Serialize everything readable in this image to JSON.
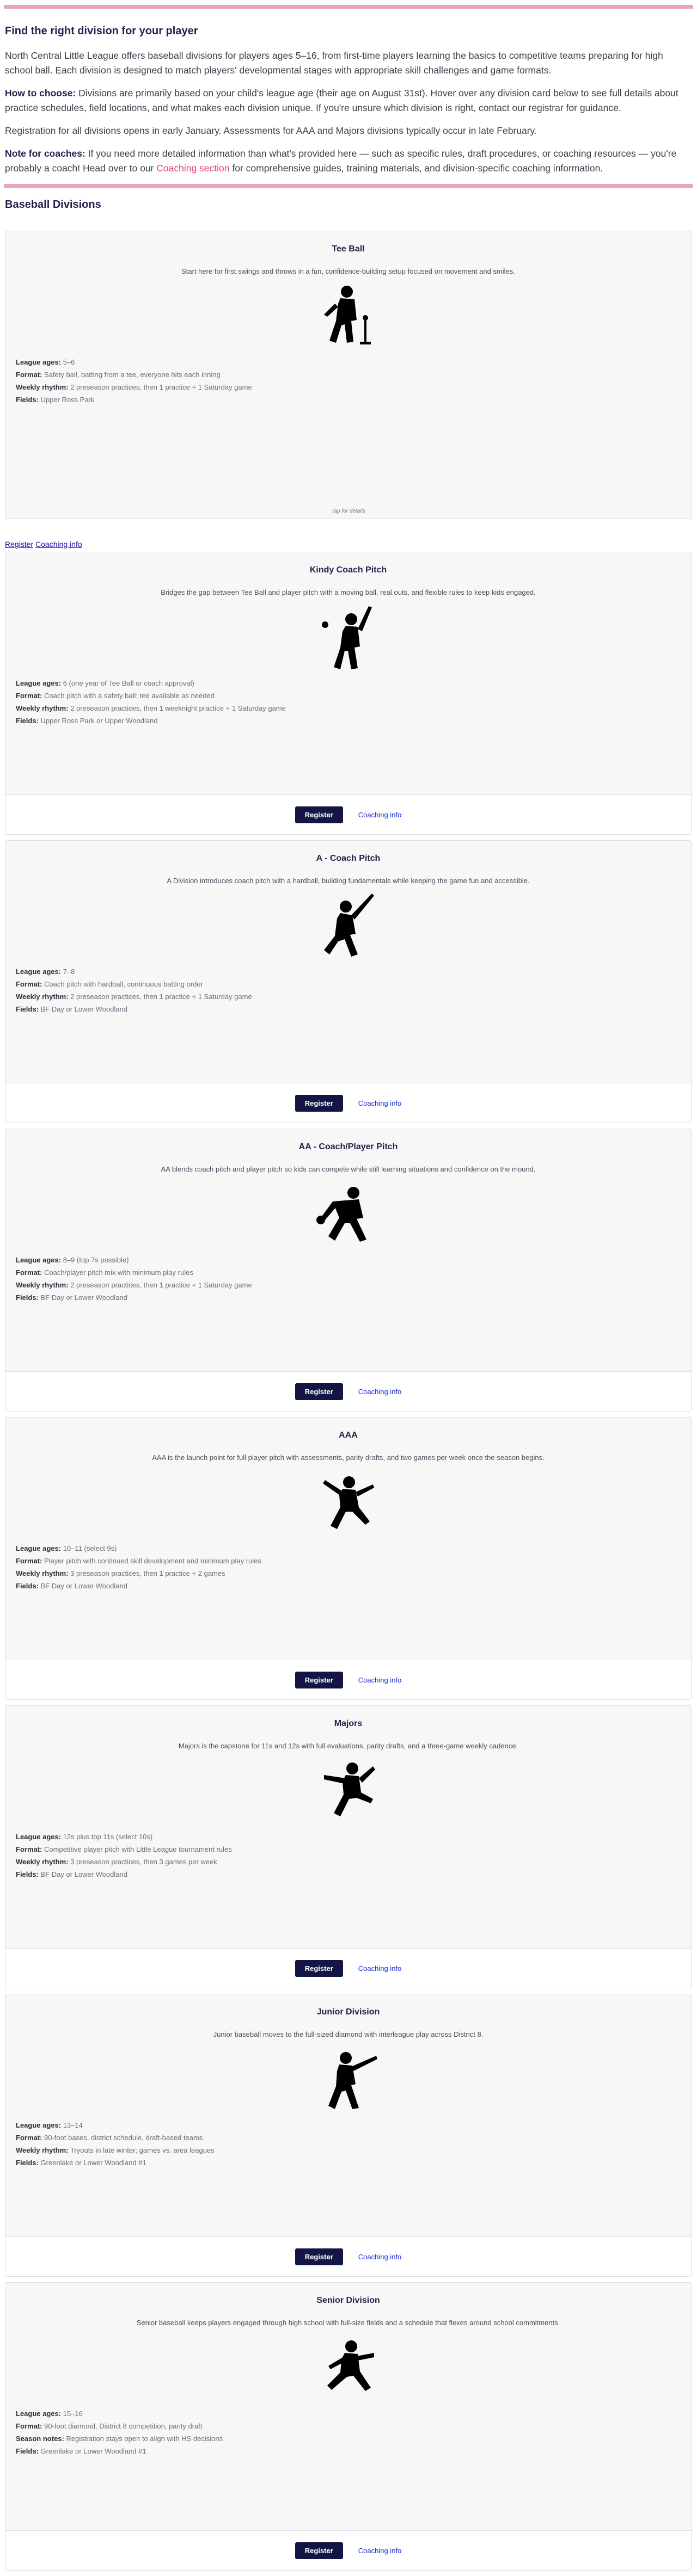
{
  "intro": {
    "title": "Find the right division for your player",
    "overview": "North Central Little League offers baseball divisions for players ages 5–16, from first-time players learning the basics to competitive teams preparing for high school ball. Each division is designed to match players' developmental stages with appropriate skill challenges and game formats.",
    "how_label": "How to choose:",
    "how_text": " Divisions are primarily based on your child's league age (their age on August 31st). Hover over any division card below to see full details about practice schedules, field locations, and what makes each division unique. If you're unsure which division is right, contact our registrar for guidance.",
    "registration": "Registration for all divisions opens in early January. Assessments for AAA and Majors divisions typically occur in late February.",
    "coach_label": "Note for coaches:",
    "coach_text_a": " If you need more detailed information than what's provided here — such as specific rules, draft procedures, or coaching resources — you're probably a coach! Head over to our ",
    "coach_link": "Coaching section",
    "coach_text_b": " for comprehensive guides, training materials, and division-specific coaching information."
  },
  "section_title": "Baseball Divisions",
  "plain_links": {
    "register": "Register",
    "coaching": "Coaching info"
  },
  "labels": {
    "league_ages": "League ages:",
    "format": "Format:",
    "weekly_rhythm": "Weekly rhythm:",
    "season_notes": "Season notes:",
    "fields": "Fields:",
    "register": "Register",
    "coaching_info": "Coaching info",
    "tap_details": "Tap for details"
  },
  "divisions": [
    {
      "name": "Tee Ball",
      "description": "Start here for first swings and throws in a fun, confidence-building setup focused on movement and smiles.",
      "icon": "tee-ball-batter-icon",
      "ages": "5–6",
      "format": "Safety ball, batting from a tee, everyone hits each inning",
      "rhythm_label": "Weekly rhythm:",
      "rhythm": "2 preseason practices, then 1 practice + 1 Saturday game",
      "fields": "Upper Ross Park"
    },
    {
      "name": "Kindy Coach Pitch",
      "description": "Bridges the gap between Tee Ball and player pitch with a moving ball, real outs, and flexible rules to keep kids engaged.",
      "icon": "batter-with-ball-icon",
      "ages": "6 (one year of Tee Ball or coach approval)",
      "format": "Coach pitch with a safety ball; tee available as needed",
      "rhythm_label": "Weekly rhythm:",
      "rhythm": "2 preseason practices, then 1 weeknight practice + 1 Saturday game",
      "fields": "Upper Ross Park or Upper Woodland"
    },
    {
      "name": "A - Coach Pitch",
      "description": "A Division introduces coach pitch with a hardball, building fundamentals while keeping the game fun and accessible.",
      "icon": "batter-swinging-icon",
      "ages": "7–8",
      "format": "Coach pitch with hardball, continuous batting order",
      "rhythm_label": "Weekly rhythm:",
      "rhythm": "2 preseason practices, then 1 practice + 1 Saturday game",
      "fields": "BF Day or Lower Woodland"
    },
    {
      "name": "AA - Coach/Player Pitch",
      "description": "AA blends coach pitch and player pitch so kids can compete while still learning situations and confidence on the mound.",
      "icon": "fielder-crouching-icon",
      "ages": "8–9 (top 7s possible)",
      "format": "Coach/player pitch mix with minimum play rules",
      "rhythm_label": "Weekly rhythm:",
      "rhythm": "2 preseason practices, then 1 practice + 1 Saturday game",
      "fields": "BF Day or Lower Woodland"
    },
    {
      "name": "AAA",
      "description": "AAA is the launch point for full player pitch with assessments, parity drafts, and two games per week once the season begins.",
      "icon": "pitcher-icon",
      "ages": "10–11 (select 9s)",
      "format": "Player pitch with continued skill development and minimum play rules",
      "rhythm_label": "Weekly rhythm:",
      "rhythm": "3 preseason practices, then 1 practice + 2 games",
      "fields": "BF Day or Lower Woodland"
    },
    {
      "name": "Majors",
      "description": "Majors is the capstone for 11s and 12s with full evaluations, parity drafts, and a three-game weekly cadence.",
      "icon": "pitcher-windup-icon",
      "ages": "12s plus top 11s (select 10s)",
      "format": "Competitive player pitch with Little League tournament rules",
      "rhythm_label": "Weekly rhythm:",
      "rhythm": "3 preseason practices, then 3 games per week",
      "fields": "BF Day or Lower Woodland"
    },
    {
      "name": "Junior Division",
      "description": "Junior baseball moves to the full-sized diamond with interleague play across District 8.",
      "icon": "batter-follow-through-icon",
      "ages": "13–14",
      "format": "90-foot bases, district schedule, draft-based teams",
      "rhythm_label": "Weekly rhythm:",
      "rhythm": "Tryouts in late winter; games vs. area leagues",
      "fields": "Greenlake or Lower Woodland #1"
    },
    {
      "name": "Senior Division",
      "description": "Senior baseball keeps players engaged through high school with full-size fields and a schedule that flexes around school commitments.",
      "icon": "infielder-throwing-icon",
      "ages": "15–16",
      "format": "90-foot diamond, District 8 competition, parity draft",
      "rhythm_label": "Season notes:",
      "rhythm": "Registration stays open to align with HS decisions",
      "fields": "Greenlake or Lower Woodland #1"
    }
  ]
}
